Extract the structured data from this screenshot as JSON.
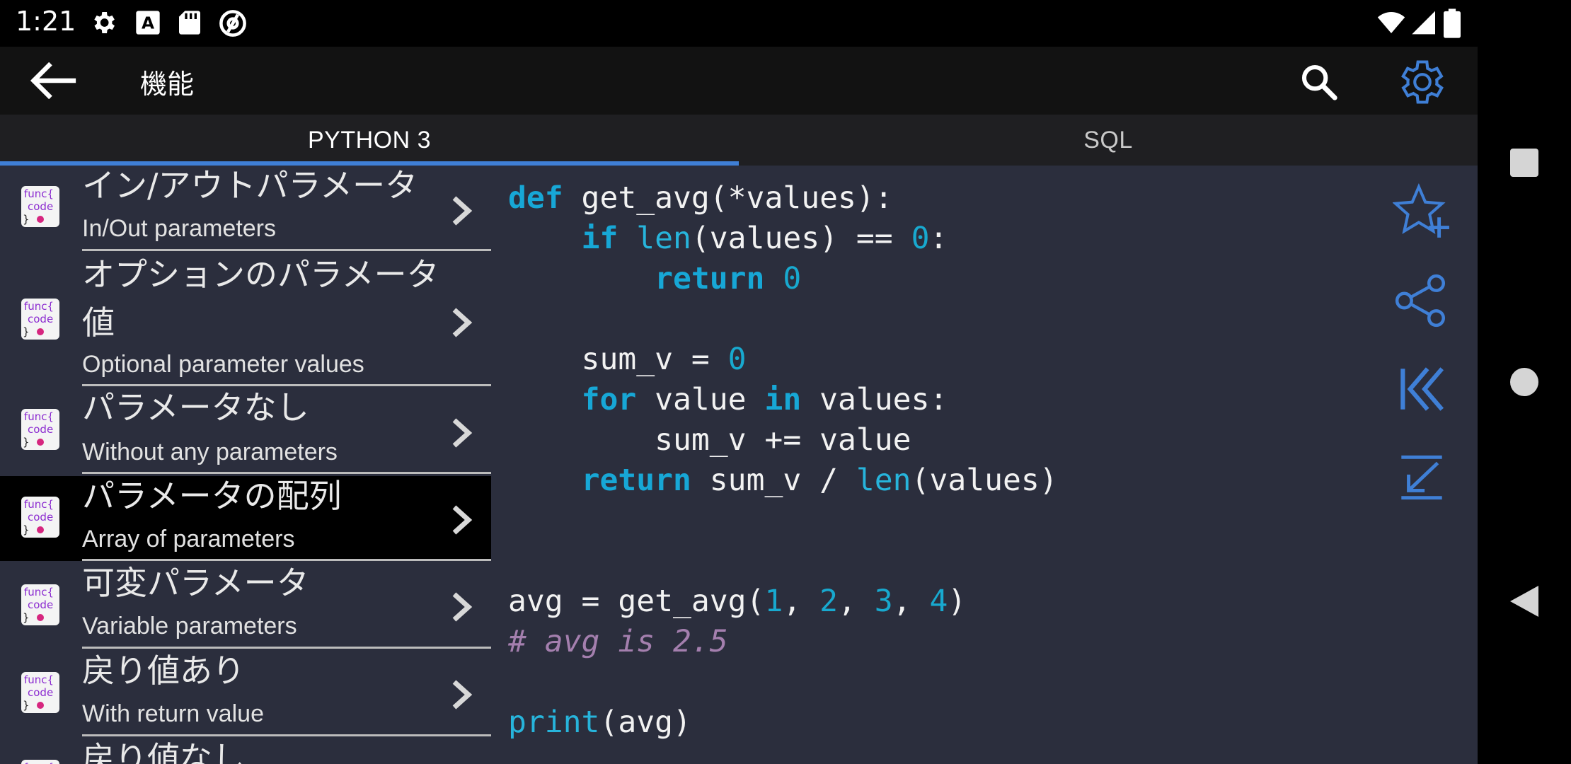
{
  "status_bar": {
    "time": "1:21",
    "icons": [
      "settings-icon",
      "font-icon",
      "sd-card-icon",
      "at-sign-icon",
      "wifi-icon",
      "signal-icon",
      "battery-icon"
    ]
  },
  "app_bar": {
    "title": "機能",
    "back_icon": "arrow-left-icon",
    "search_icon": "search-icon",
    "settings_icon": "gear-icon"
  },
  "tabs": [
    {
      "label": "PYTHON 3",
      "selected": true
    },
    {
      "label": "SQL",
      "selected": false
    }
  ],
  "list": {
    "items": [
      {
        "jp": "イン/アウトパラメータ",
        "en": "In/Out parameters",
        "selected": false
      },
      {
        "jp": "オプションのパラメータ値",
        "en": "Optional parameter values",
        "selected": false
      },
      {
        "jp": "パラメータなし",
        "en": "Without any parameters",
        "selected": false
      },
      {
        "jp": "パラメータの配列",
        "en": "Array of parameters",
        "selected": true
      },
      {
        "jp": "可変パラメータ",
        "en": "Variable parameters",
        "selected": false
      },
      {
        "jp": "戻り値あり",
        "en": "With return value",
        "selected": false
      },
      {
        "jp": "戻り値なし",
        "en": "",
        "selected": false
      }
    ],
    "icon_text": {
      "line1": "func{",
      "line2": "code",
      "line3": "}"
    }
  },
  "code": {
    "language": "python",
    "lines": [
      "def get_avg(*values):",
      "    if len(values) == 0:",
      "        return 0",
      "",
      "    sum_v = 0",
      "    for value in values:",
      "        sum_v += value",
      "    return sum_v / len(values)",
      "",
      "",
      "avg = get_avg(1, 2, 3, 4)",
      "# avg is 2.5",
      "",
      "print(avg)"
    ]
  },
  "actions": [
    "star-add-icon",
    "share-icon",
    "skip-to-start-icon",
    "arrow-down-left-icon"
  ],
  "nav_bar": [
    "recents-square-icon",
    "home-circle-icon",
    "back-triangle-icon"
  ],
  "colors": {
    "accent": "#3f7fd6",
    "content_bg": "#2b2e3d",
    "keyword": "#17a7d6",
    "comment": "#a47fae"
  }
}
